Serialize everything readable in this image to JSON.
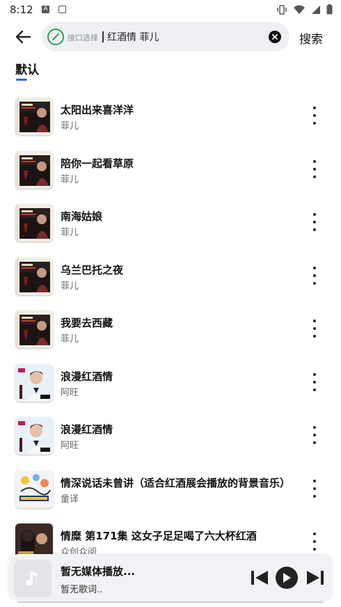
{
  "status": {
    "time": "8:12",
    "icons": [
      "a-icon",
      "square-icon",
      "vibrate-icon",
      "wifi-icon",
      "signal-icon",
      "battery-icon"
    ]
  },
  "top_bar": {
    "interface_label": "接口选择",
    "search_value": "红酒情 菲儿",
    "search_button": "搜索"
  },
  "tabs": [
    {
      "label": "默认",
      "active": true
    }
  ],
  "songs": [
    {
      "title": "太阳出来喜洋洋",
      "artist": "菲儿",
      "cover": "feier"
    },
    {
      "title": "陪你一起看草原",
      "artist": "菲儿",
      "cover": "feier"
    },
    {
      "title": "南海姑娘",
      "artist": "菲儿",
      "cover": "feier"
    },
    {
      "title": "乌兰巴托之夜",
      "artist": "菲儿",
      "cover": "feier"
    },
    {
      "title": "我要去西藏",
      "artist": "菲儿",
      "cover": "feier"
    },
    {
      "title": "浪漫红酒情",
      "artist": "阿旺",
      "cover": "awang"
    },
    {
      "title": "浪漫红酒情",
      "artist": "阿旺",
      "cover": "awang"
    },
    {
      "title": "情深说话未曾讲（适合红酒展会播放的背景音乐）",
      "artist": "童译",
      "cover": "bgm"
    },
    {
      "title": "情糜 第171集 这女子足足喝了六大杯红酒",
      "artist": "众创众阅",
      "cover": "drama"
    }
  ],
  "player": {
    "title": "暂无媒体播放...",
    "lyric": "暂无歌词.."
  },
  "colors": {
    "accent": "#2a6fdb",
    "link_green": "#2e9e4a",
    "search_bg": "#eef0f4",
    "player_bg": "#f1f2f5"
  }
}
